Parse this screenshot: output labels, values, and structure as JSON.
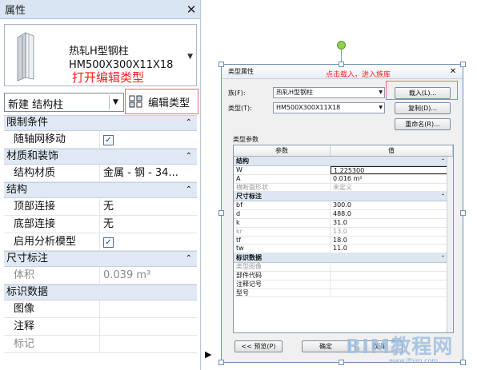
{
  "props": {
    "title": "属性",
    "type_name": "热轧H型钢柱",
    "type_size": "HM500X300X11X18",
    "note": "打开编辑类型",
    "instance_filter": "新建 结构柱",
    "edit_type": "编辑类型",
    "groups": [
      {
        "name": "限制条件",
        "toggle": "⌃",
        "rows": [
          {
            "name": "随轴网移动",
            "value": "",
            "check": true
          }
        ]
      },
      {
        "name": "材质和装饰",
        "toggle": "⌃",
        "rows": [
          {
            "name": "结构材质",
            "value": "金属 - 钢 - 34..."
          }
        ]
      },
      {
        "name": "结构",
        "toggle": "⌃",
        "rows": [
          {
            "name": "顶部连接",
            "value": "无"
          },
          {
            "name": "底部连接",
            "value": "无"
          },
          {
            "name": "启用分析模型",
            "value": "",
            "check": true
          }
        ]
      },
      {
        "name": "尺寸标注",
        "toggle": "⌃",
        "rows": [
          {
            "name": "体积",
            "value": "0.039 m³",
            "grey": true
          }
        ]
      },
      {
        "name": "标识数据",
        "toggle": "",
        "rows": [
          {
            "name": "图像",
            "value": ""
          },
          {
            "name": "注释",
            "value": ""
          },
          {
            "name": "标记",
            "value": "",
            "grey": true
          }
        ]
      }
    ]
  },
  "dialog": {
    "title": "类型属性",
    "family_label": "族(F):",
    "family_value": "热轧H型钢柱",
    "type_label": "类型(T):",
    "type_value": "HM500X300X11X18",
    "load_btn": "载入(L)...",
    "dup_btn": "复制(D)...",
    "rename_btn": "重命名(R)...",
    "note": "点击载入，进入族库",
    "type_params": "类型参数",
    "col_param": "参数",
    "col_value": "值",
    "groups": [
      {
        "name": "结构",
        "rows": [
          {
            "name": "W",
            "value": "1.225300",
            "edit": true
          },
          {
            "name": "A",
            "value": "0.016 m²"
          },
          {
            "name": "横断面形状",
            "value": "未定义",
            "grey": true
          }
        ]
      },
      {
        "name": "尺寸标注",
        "rows": [
          {
            "name": "bf",
            "value": "300.0"
          },
          {
            "name": "d",
            "value": "488.0"
          },
          {
            "name": "k",
            "value": "31.0"
          },
          {
            "name": "kr",
            "value": "13.0",
            "grey": true
          },
          {
            "name": "tf",
            "value": "18.0"
          },
          {
            "name": "tw",
            "value": "11.0"
          }
        ]
      },
      {
        "name": "标识数据",
        "rows": [
          {
            "name": "类型图像",
            "value": "",
            "grey": true
          },
          {
            "name": "部件代码",
            "value": ""
          },
          {
            "name": "注释记号",
            "value": ""
          },
          {
            "name": "型号",
            "value": ""
          }
        ]
      }
    ],
    "preview_btn": "<< 预览(P)",
    "ok_btn": "确定",
    "cancel_btn": "取消"
  },
  "watermark": "BIM教程网",
  "watermark_url": "www.lfbim.com"
}
